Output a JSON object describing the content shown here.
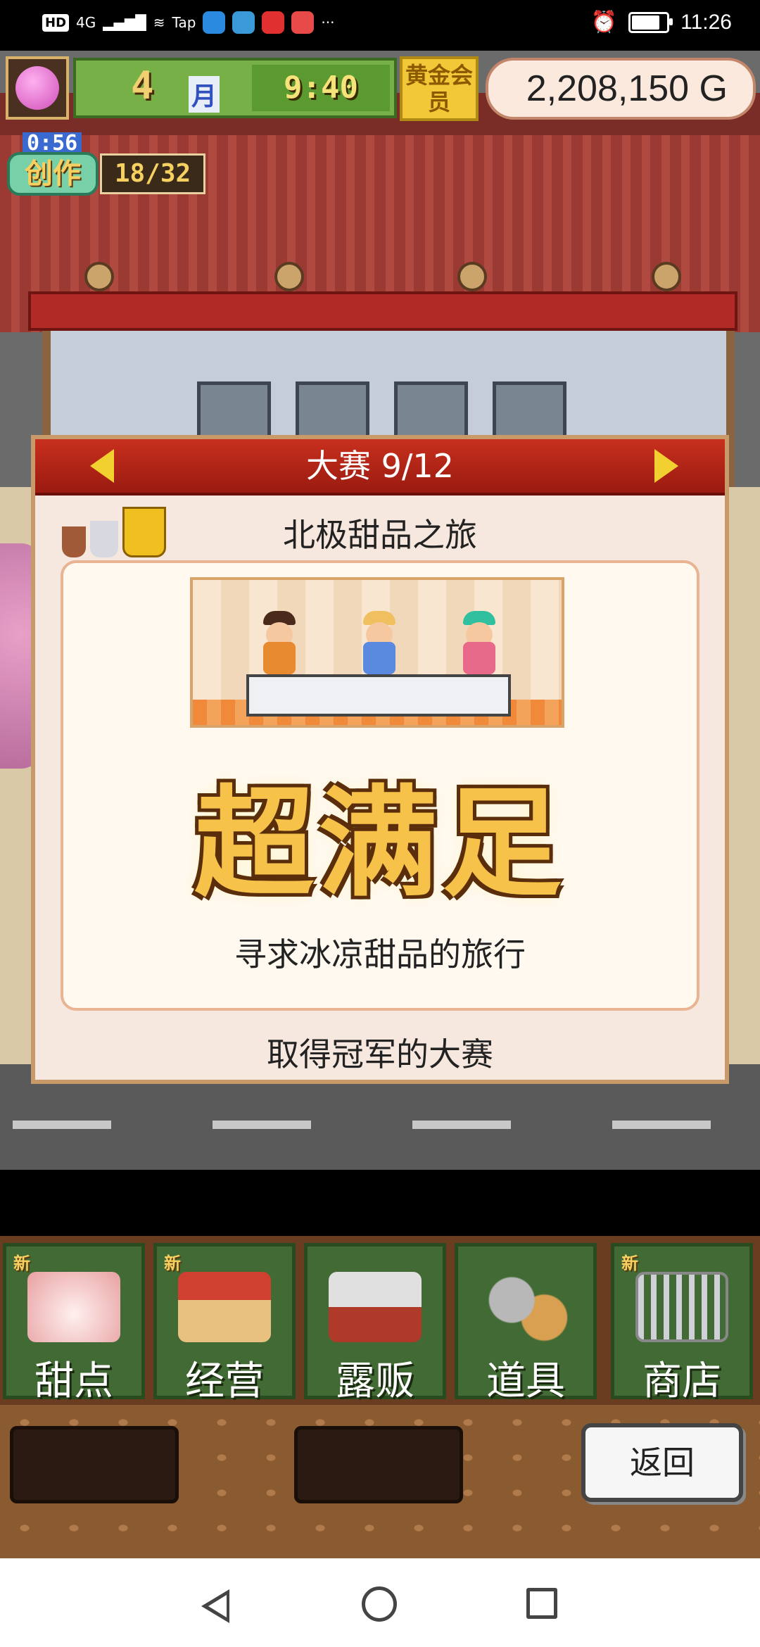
{
  "status_bar": {
    "network": "HD",
    "signal_type": "4G",
    "tap_label": "Tap",
    "more": "···",
    "time": "11:26",
    "battery_level": 0.85
  },
  "hud": {
    "month_number": "4",
    "month_label": "月",
    "clock": "9:40",
    "gold_member": "黄金会员",
    "money": "2,208,150 G",
    "create_timer": "0:56",
    "create_label": "创作",
    "create_count": "18/32"
  },
  "dialog": {
    "title": "大赛 9/12",
    "contest_name": "北极甜品之旅",
    "result": "超满足",
    "subtitle": "寻求冰凉甜品的旅行",
    "footer": "取得冠军的大赛",
    "trophies": [
      "bronze-trophy",
      "silver-trophy",
      "gold-trophy"
    ]
  },
  "menu": {
    "new_badge": "新",
    "items": [
      {
        "label": "甜点",
        "icon": "cake-icon",
        "has_new": true
      },
      {
        "label": "经营",
        "icon": "shop-icon",
        "has_new": true
      },
      {
        "label": "露贩",
        "icon": "food-truck-icon",
        "has_new": false
      },
      {
        "label": "道具",
        "icon": "items-bag-icon",
        "has_new": false
      },
      {
        "label": "商店",
        "icon": "shopping-cart-icon",
        "has_new": true
      }
    ]
  },
  "back_button": "返回",
  "colors": {
    "dialog_header": "#b8281a",
    "menu_tile": "#416a34",
    "result_text": "#f6c24a",
    "gold_member_bg": "#f2c838"
  }
}
